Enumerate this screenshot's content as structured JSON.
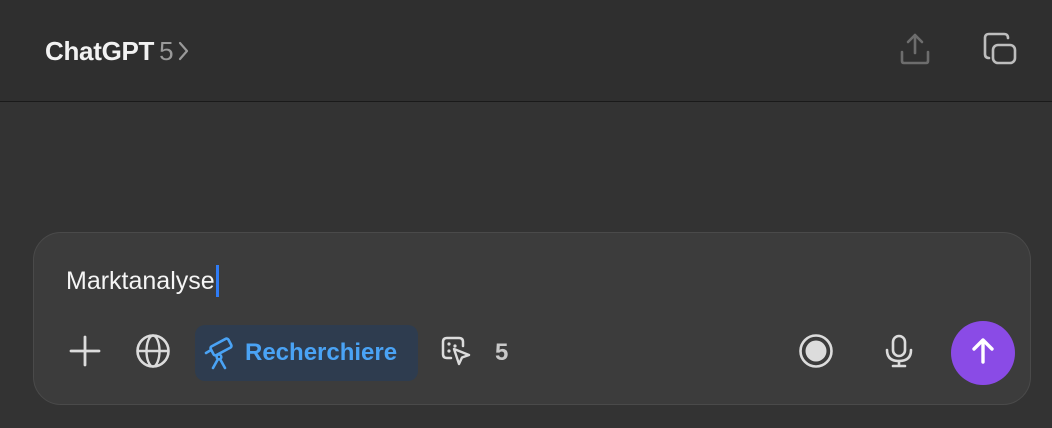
{
  "header": {
    "model_name": "ChatGPT",
    "model_version": "5",
    "icons": [
      "chevron-right-icon",
      "share-icon",
      "temporary-chat-icon"
    ]
  },
  "composer": {
    "input_value": "Marktanalyse",
    "research_label": "Recherchiere",
    "count": "5",
    "icons": [
      "plus-icon",
      "globe-icon",
      "telescope-icon",
      "agent-cursor-icon",
      "voice-mode-icon",
      "microphone-icon",
      "arrow-up-icon"
    ]
  },
  "colors": {
    "background": "#333333",
    "header_background": "#2f2f2f",
    "composer_background": "#3c3c3c",
    "accent_blue": "#4aa3f5",
    "research_pill": "#2e3c4f",
    "send_button": "#8a4be6",
    "caret": "#2f7cf6"
  }
}
